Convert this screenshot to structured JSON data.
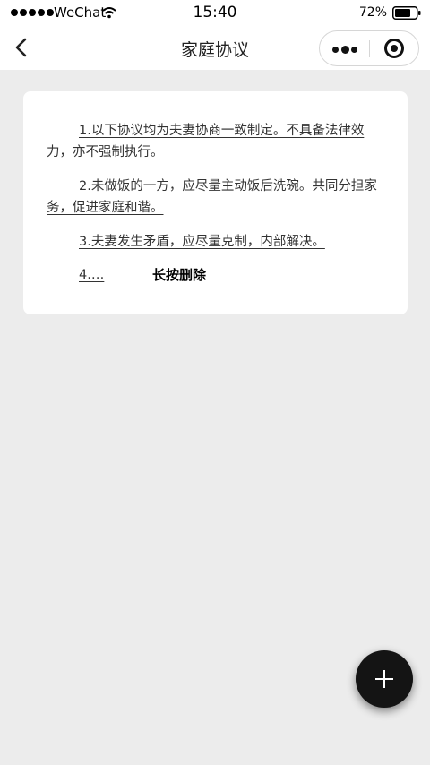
{
  "status_bar": {
    "carrier": "WeChat",
    "time": "15:40",
    "battery": "72%"
  },
  "nav": {
    "title": "家庭协议",
    "back_icon": "chevron-left-icon",
    "more_icon": "more-dots-icon",
    "close_icon": "target-icon"
  },
  "agreement": {
    "items": [
      "1.以下协议均为夫妻协商一致制定。不具备法律效力，亦不强制执行。",
      "2.未做饭的一方，应尽量主动饭后洗碗。共同分担家务，促进家庭和谐。",
      "3.夫妻发生矛盾，应尽量克制，内部解决。",
      "4.…"
    ],
    "delete_hint": "长按删除"
  },
  "fab": {
    "icon": "plus-icon"
  },
  "colors": {
    "page_background": "#ececec",
    "card_background": "#ffffff",
    "text": "#333333",
    "fab": "#141414"
  }
}
